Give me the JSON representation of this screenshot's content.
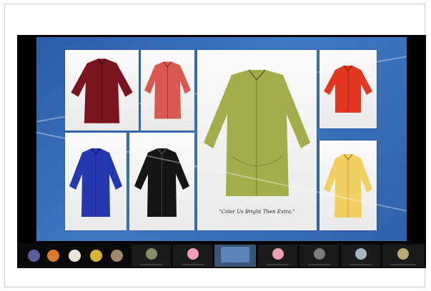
{
  "slide": {
    "caption": "\"Color Us Bright Then Extra.\"",
    "shirts": [
      {
        "name": "dark-red-shirt",
        "color": "#7a1520"
      },
      {
        "name": "coral-red-shirt",
        "color": "#d9574f"
      },
      {
        "name": "olive-green-shirt",
        "color": "#a4ad4c"
      },
      {
        "name": "bright-red-shirt",
        "color": "#e2361e"
      },
      {
        "name": "royal-blue-shirt",
        "color": "#2438b0"
      },
      {
        "name": "black-shirt",
        "color": "#151515"
      },
      {
        "name": "yellow-shirt",
        "color": "#f2cf61"
      }
    ]
  },
  "participants": [
    {
      "icon": "participant-avatar-icon",
      "color": "#5a5e9a"
    },
    {
      "icon": "participant-avatar-icon",
      "color": "#d77b2d"
    },
    {
      "icon": "participant-avatar-icon",
      "color": "#e8e4d9"
    },
    {
      "icon": "participant-avatar-icon",
      "color": "#d8b33a"
    },
    {
      "icon": "participant-avatar-icon",
      "color": "#9f8b6c"
    },
    {
      "icon": "participant-avatar-icon",
      "color": "#8a8d63"
    },
    {
      "icon": "participant-avatar-icon",
      "color": "#ef9fb5"
    },
    {
      "icon": "participant-avatar-icon",
      "color": "#5b84b8"
    },
    {
      "icon": "participant-avatar-icon",
      "color": "#ef9fb5"
    },
    {
      "icon": "participant-avatar-icon",
      "color": "#7d7d7d"
    },
    {
      "icon": "participant-avatar-icon",
      "color": "#a6b7c4"
    },
    {
      "icon": "participant-avatar-icon",
      "color": "#b8a978"
    }
  ]
}
